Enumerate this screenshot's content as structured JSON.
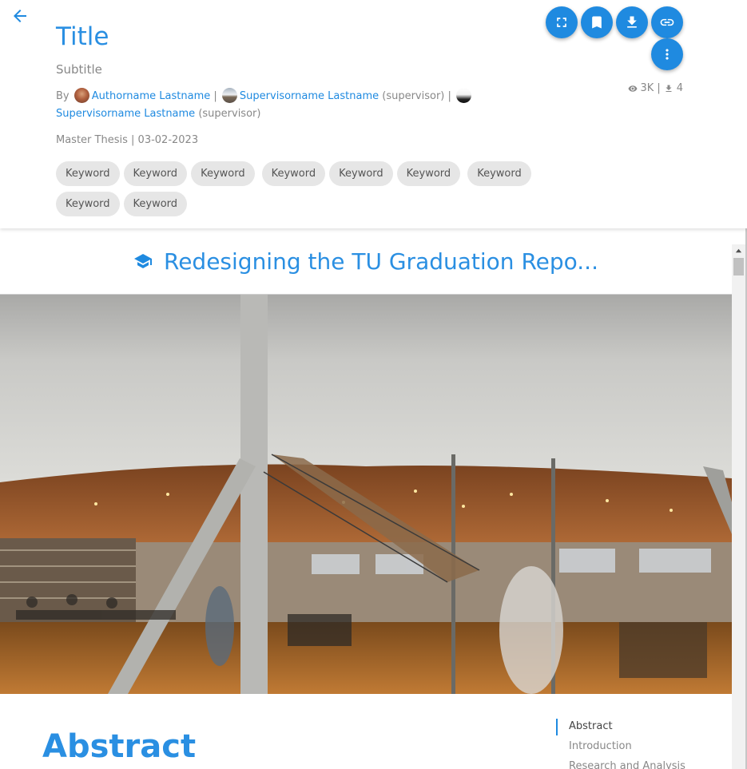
{
  "header": {
    "title": "Title",
    "subtitle": "Subtitle",
    "by_label": "By",
    "authors": [
      {
        "name": "Authorname Lastname",
        "role": ""
      },
      {
        "name": "Supervisorname Lastname",
        "role": "(supervisor)"
      },
      {
        "name": "Supervisorname Lastname",
        "role": "(supervisor)"
      }
    ],
    "separator": "|",
    "doc_type": "Master Thesis",
    "date": "03-02-2023",
    "keywords": [
      "Keyword",
      "Keyword",
      "Keyword",
      "Keyword",
      "Keyword",
      "Keyword",
      "Keyword",
      "Keyword",
      "Keyword"
    ],
    "stats": {
      "views": "3K",
      "downloads": "4"
    }
  },
  "actions": {
    "icons": [
      "fullscreen-icon",
      "bookmark-icon",
      "download-icon",
      "link-icon",
      "more-vertical-icon"
    ]
  },
  "document": {
    "title": "Redesigning the TU Graduation Repo...",
    "hero_image": "library-interior-photo",
    "abstract_heading": "Abstract",
    "toc": [
      "Abstract",
      "Introduction",
      "Research and Analysis"
    ]
  },
  "colors": {
    "accent": "#1f8ae0",
    "chip_bg": "#e6e6e6",
    "muted_text": "#888888"
  }
}
